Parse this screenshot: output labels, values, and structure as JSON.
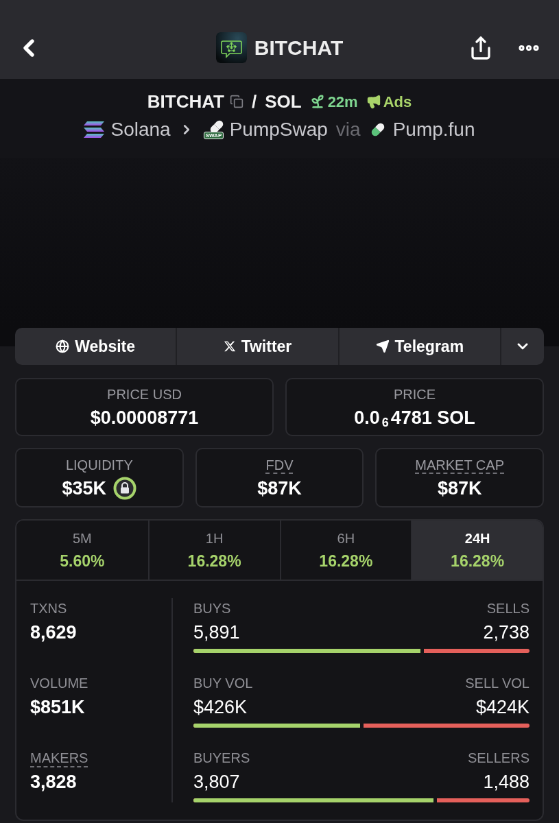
{
  "nav": {
    "title": "BITCHAT"
  },
  "pair": {
    "base": "BITCHAT",
    "slash": "/",
    "quote": "SOL",
    "age": "22m",
    "ads": "Ads"
  },
  "route": {
    "chain": "Solana",
    "dex": "PumpSwap",
    "dex_badge": "SWAP",
    "via": "via",
    "launchpad": "Pump.fun"
  },
  "links": [
    {
      "kind": "website",
      "label": "Website"
    },
    {
      "kind": "twitter",
      "label": "Twitter"
    },
    {
      "kind": "telegram",
      "label": "Telegram"
    }
  ],
  "price_cards": [
    {
      "label": "PRICE USD",
      "value": "$0.00008771"
    },
    {
      "label": "PRICE",
      "value": "0.0$_{6}$4781 SOL"
    }
  ],
  "metric_cards": [
    {
      "label": "LIQUIDITY",
      "value": "$35K",
      "locked": true,
      "tooltip": false
    },
    {
      "label": "FDV",
      "value": "$87K",
      "locked": false,
      "tooltip": true
    },
    {
      "label": "MARKET CAP",
      "value": "$87K",
      "locked": false,
      "tooltip": true
    }
  ],
  "timeframes": [
    {
      "label": "5M",
      "change": "5.60%",
      "selected": false
    },
    {
      "label": "1H",
      "change": "16.28%",
      "selected": false
    },
    {
      "label": "6H",
      "change": "16.28%",
      "selected": false
    },
    {
      "label": "24H",
      "change": "16.28%",
      "selected": true
    }
  ],
  "stats": [
    {
      "label": "TXNS",
      "value": "8,629",
      "tooltip": false
    },
    {
      "label": "VOLUME",
      "value": "$851K",
      "tooltip": false
    },
    {
      "label": "MAKERS",
      "value": "3,828",
      "tooltip": true
    }
  ],
  "splits": [
    {
      "left_label": "BUYS",
      "left_value": "5,891",
      "right_label": "SELLS",
      "right_value": "2,738",
      "level": 0.68
    },
    {
      "left_label": "BUY VOL",
      "left_value": "$426K",
      "right_label": "SELL VOL",
      "right_value": "$424K",
      "level": 0.5
    },
    {
      "left_label": "BUYERS",
      "left_value": "3,807",
      "right_label": "SELLERS",
      "right_value": "1,488",
      "level": 0.72
    }
  ]
}
